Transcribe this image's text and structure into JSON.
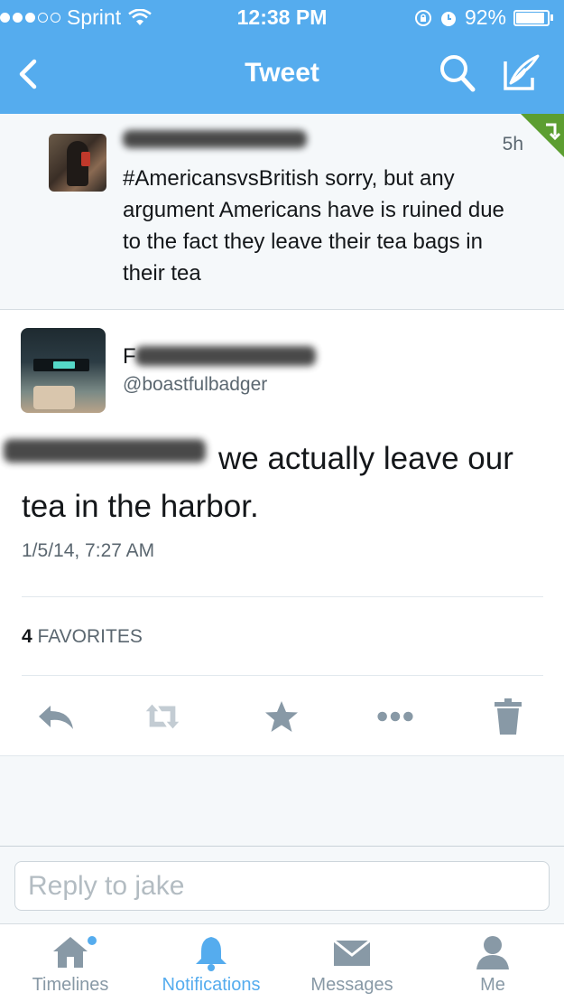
{
  "status_bar": {
    "carrier": "Sprint",
    "signal_bars_filled": 3,
    "signal_bars_total": 5,
    "time": "12:38 PM",
    "battery_percent": "92%",
    "battery_level": 0.92
  },
  "nav": {
    "title": "Tweet",
    "back_icon": "chevron-left-icon",
    "search_icon": "search-icon",
    "compose_icon": "compose-icon"
  },
  "prev_tweet": {
    "time": "5h",
    "text": "#AmericansvsBritish sorry, but any argument Americans have is ruined due to the fact they leave their tea bags in their tea"
  },
  "main_tweet": {
    "name_initial": "F",
    "handle": "@boastfulbadger",
    "text": "we actually leave our tea in the harbor.",
    "date": "1/5/14, 7:27 AM",
    "favorites_count": "4",
    "favorites_label": "FAVORITES"
  },
  "actions": [
    "reply-icon",
    "retweet-icon",
    "favorite-icon",
    "more-icon",
    "delete-icon"
  ],
  "reply": {
    "placeholder": "Reply to jake"
  },
  "tabs": [
    {
      "label": "Timelines",
      "icon": "home-icon",
      "active": false
    },
    {
      "label": "Notifications",
      "icon": "bell-icon",
      "active": true
    },
    {
      "label": "Messages",
      "icon": "envelope-icon",
      "active": false
    },
    {
      "label": "Me",
      "icon": "person-icon",
      "active": false
    }
  ],
  "colors": {
    "brand": "#55acee",
    "icon_gray": "#8899a6",
    "retweet_green": "#5c9e31"
  }
}
